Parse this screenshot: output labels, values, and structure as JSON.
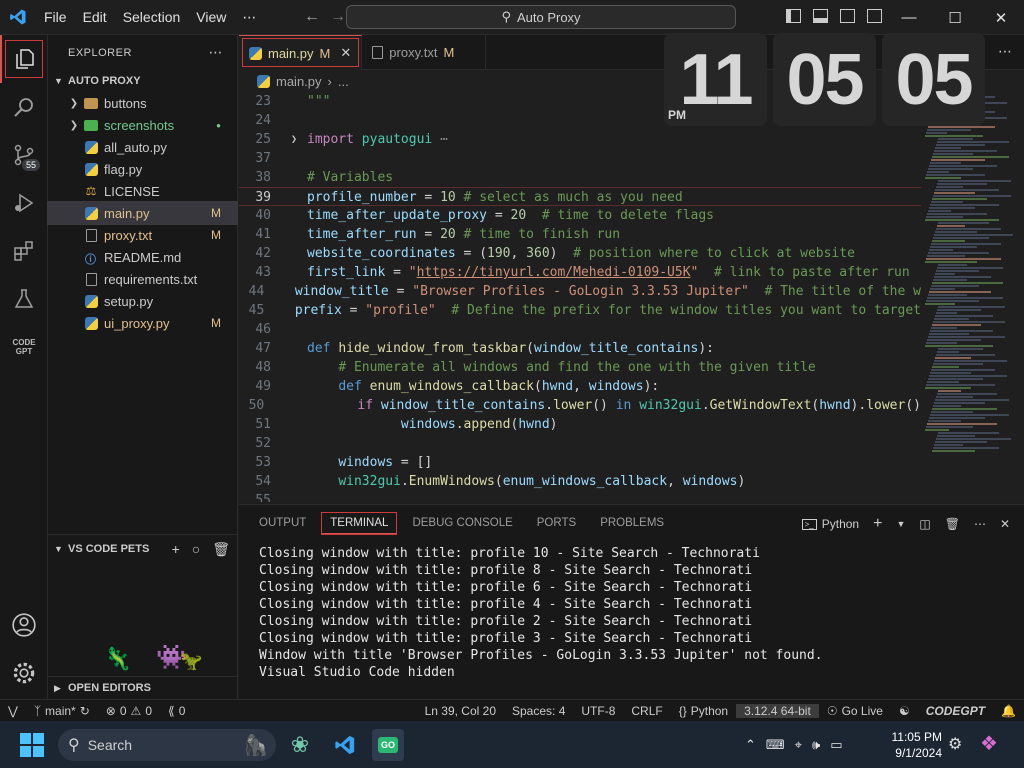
{
  "titlebar": {
    "menu": [
      "File",
      "Edit",
      "Selection",
      "View",
      "⋯"
    ],
    "command_center": "Auto Proxy"
  },
  "activity": {
    "source_control_badge": "55",
    "codegpt_label": "CODE GPT"
  },
  "explorer": {
    "title": "EXPLORER",
    "section": "AUTO PROXY",
    "items": [
      {
        "label": "buttons",
        "type": "folder",
        "decoration": ""
      },
      {
        "label": "screenshots",
        "type": "folder-green",
        "decoration": "●"
      },
      {
        "label": "all_auto.py",
        "type": "py",
        "decoration": ""
      },
      {
        "label": "flag.py",
        "type": "py",
        "decoration": ""
      },
      {
        "label": "LICENSE",
        "type": "license",
        "decoration": ""
      },
      {
        "label": "main.py",
        "type": "py",
        "decoration": "M"
      },
      {
        "label": "proxy.txt",
        "type": "txt",
        "decoration": "M"
      },
      {
        "label": "README.md",
        "type": "md",
        "decoration": ""
      },
      {
        "label": "requirements.txt",
        "type": "txt",
        "decoration": ""
      },
      {
        "label": "setup.py",
        "type": "py",
        "decoration": ""
      },
      {
        "label": "ui_proxy.py",
        "type": "py",
        "decoration": "M"
      }
    ],
    "pets_title": "VS CODE PETS",
    "open_editors": "OPEN EDITORS"
  },
  "tabs": [
    {
      "label": "main.py",
      "mod": "M"
    },
    {
      "label": "proxy.txt",
      "mod": "M"
    }
  ],
  "breadcrumb": {
    "file": "main.py",
    "rest": "..."
  },
  "clock": {
    "hour": "11",
    "minute": "05",
    "second": "05",
    "ampm": "PM"
  },
  "panel": {
    "tabs": [
      "OUTPUT",
      "TERMINAL",
      "DEBUG CONSOLE",
      "PORTS",
      "PROBLEMS"
    ],
    "shell": "Python",
    "terminal_lines": [
      "Closing window with title: profile 10 - Site Search - Technorati",
      "Closing window with title: profile 8 - Site Search - Technorati",
      "Closing window with title: profile 6 - Site Search - Technorati",
      "Closing window with title: profile 4 - Site Search - Technorati",
      "Closing window with title: profile 2 - Site Search - Technorati",
      "Closing window with title: profile 3 - Site Search - Technorati",
      "Window with title 'Browser Profiles - GoLogin 3.3.53 Jupiter' not found.",
      "Visual Studio Code hidden"
    ]
  },
  "status": {
    "branch": "main*",
    "errors": "0",
    "warnings": "0",
    "ports": "0",
    "position": "Ln 39, Col 20",
    "spaces": "Spaces: 4",
    "encoding": "UTF-8",
    "eol": "CRLF",
    "language": "Python",
    "interpreter": "3.12.4 64-bit",
    "golive": "Go Live",
    "codegpt": "CODEGPT"
  },
  "taskbar": {
    "search": "Search",
    "time": "11:05 PM",
    "date": "9/1/2024"
  },
  "colors": {
    "accent": "#d9534f",
    "modified": "#e2c08d",
    "blue": "#0078d4"
  }
}
